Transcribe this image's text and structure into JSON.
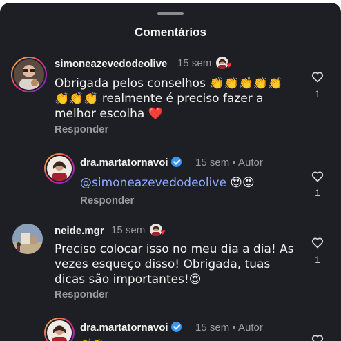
{
  "header": {
    "title": "Comentários"
  },
  "comments": [
    {
      "username": "simoneazevedodeolive",
      "time": "15 sem",
      "text_line1": "Obrigada pelos conselhos 👏👏👏👏👏",
      "text_line2": "👏👏👏 realmente é preciso fazer a",
      "text_line3": "melhor escolha ❤️",
      "reply_label": "Responder",
      "likes": "1"
    },
    {
      "username": "dra.martatornavoi",
      "time": "15 sem",
      "author_tag": "• Autor",
      "mention": "@simoneazevedodeolive",
      "text_after_mention": " 😍😍",
      "reply_label": "Responder",
      "likes": "1"
    },
    {
      "username": "neide.mgr",
      "time": "15 sem",
      "text_line1": "Preciso colocar isso no meu dia a dia! As",
      "text_line2": "vezes esqueço disso! Obrigada, tuas",
      "text_line3": "dicas são importantes!😍",
      "reply_label": "Responder",
      "likes": "1"
    },
    {
      "username": "dra.martatornavoi",
      "time": "15 sem",
      "author_tag": "• Autor",
      "partial_text": "👏👏"
    }
  ],
  "colors": {
    "background": "#1e1f24",
    "secondary_text": "#9a9ba0",
    "mention": "#8fa9ff",
    "heart_red": "#ff3040",
    "verified": "#3897f0"
  }
}
